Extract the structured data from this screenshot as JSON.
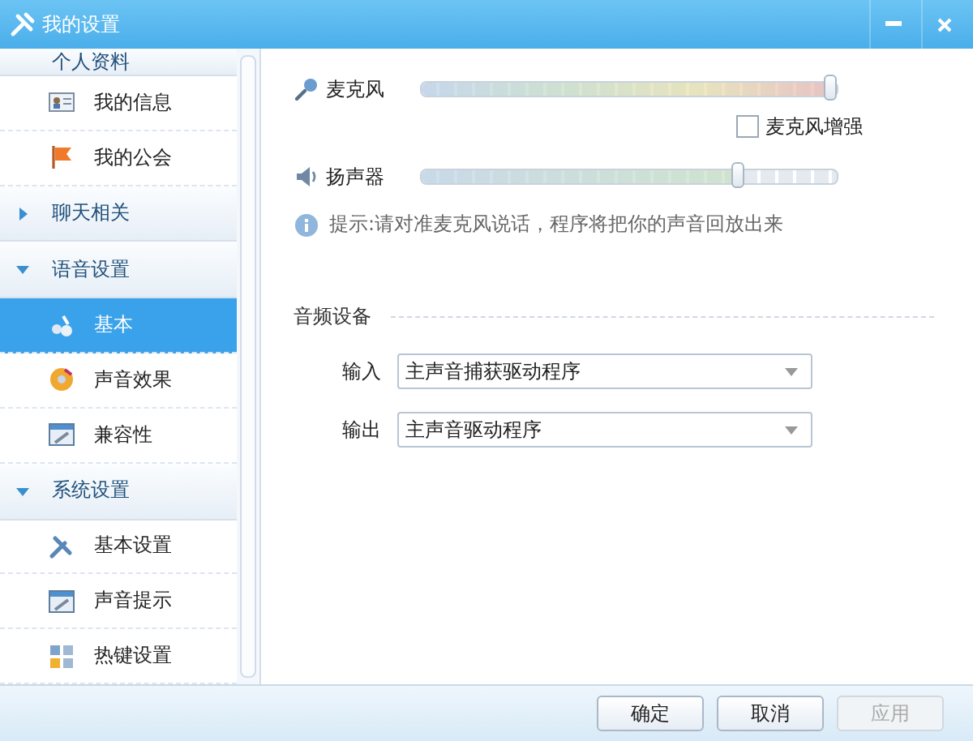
{
  "window": {
    "title": "我的设置"
  },
  "sidebar": {
    "groups": [
      {
        "label": "个人资料",
        "children": [
          {
            "label": "我的信息",
            "kind": "card",
            "selected": false
          },
          {
            "label": "我的公会",
            "kind": "flag",
            "selected": false
          }
        ]
      },
      {
        "label": "聊天相关",
        "expanded": false
      },
      {
        "label": "语音设置",
        "expanded": true,
        "children": [
          {
            "label": "基本",
            "kind": "mixer",
            "selected": true
          },
          {
            "label": "声音效果",
            "kind": "disc",
            "selected": false
          },
          {
            "label": "兼容性",
            "kind": "window",
            "selected": false
          }
        ]
      },
      {
        "label": "系统设置",
        "expanded": true,
        "children": [
          {
            "label": "基本设置",
            "kind": "tools",
            "selected": false
          },
          {
            "label": "声音提示",
            "kind": "window",
            "selected": false
          },
          {
            "label": "热键设置",
            "kind": "grid",
            "selected": false
          }
        ]
      }
    ]
  },
  "microphone": {
    "label": "麦克风",
    "level": 1.0
  },
  "boost": {
    "label": "麦克风增强",
    "checked": false
  },
  "speaker": {
    "label": "扬声器",
    "level": 0.77
  },
  "hint": "提示:请对准麦克风说话，程序将把你的声音回放出来",
  "devices": {
    "title": "音频设备",
    "rows": [
      {
        "label": "输入",
        "value": "主声音捕获驱动程序"
      },
      {
        "label": "输出",
        "value": "主声音驱动程序"
      }
    ]
  },
  "buttons": [
    {
      "label": "确定",
      "disabled": false
    },
    {
      "label": "取消",
      "disabled": false
    },
    {
      "label": "应用",
      "disabled": true
    }
  ]
}
